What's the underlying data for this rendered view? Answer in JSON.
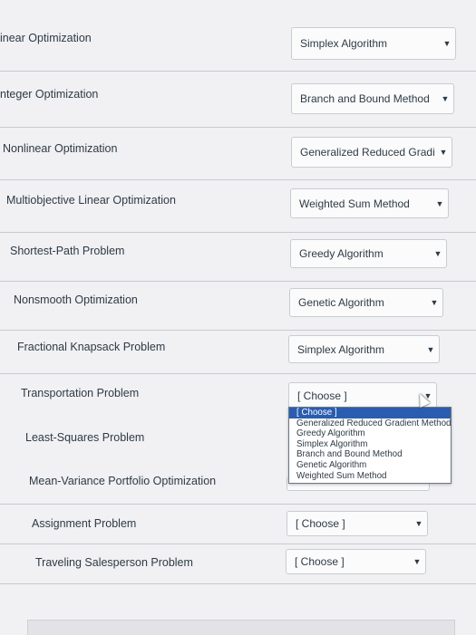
{
  "rows": [
    {
      "label": "inear Optimization",
      "selected": "Simplex Algorithm"
    },
    {
      "label": "nteger Optimization",
      "selected": "Branch and Bound Method"
    },
    {
      "label": "Nonlinear Optimization",
      "selected": "Generalized Reduced Gradien"
    },
    {
      "label": "Multiobjective Linear Optimization",
      "selected": "Weighted Sum Method"
    },
    {
      "label": "Shortest-Path Problem",
      "selected": "Greedy Algorithm"
    },
    {
      "label": "Nonsmooth Optimization",
      "selected": "Genetic Algorithm"
    },
    {
      "label": "Fractional Knapsack Problem",
      "selected": "Simplex Algorithm"
    },
    {
      "label": "Transportation Problem",
      "selected": "[ Choose ]"
    },
    {
      "label": "Least-Squares Problem",
      "selected": ""
    },
    {
      "label": "Mean-Variance Portfolio Optimization",
      "selected": ""
    },
    {
      "label": "Assignment Problem",
      "selected": "[ Choose ]"
    },
    {
      "label": "Traveling Salesperson Problem",
      "selected": "[ Choose ]"
    }
  ],
  "dropdown_options": [
    "[ Choose ]",
    "Generalized Reduced Gradient Method",
    "Greedy Algorithm",
    "Simplex Algorithm",
    "Branch and Bound Method",
    "Genetic Algorithm",
    "Weighted Sum Method"
  ],
  "dropdown_highlighted": "[ Choose ]",
  "icons": {
    "select_arrow": "chevron-down-icon",
    "pointer": "mouse-cursor-icon"
  }
}
